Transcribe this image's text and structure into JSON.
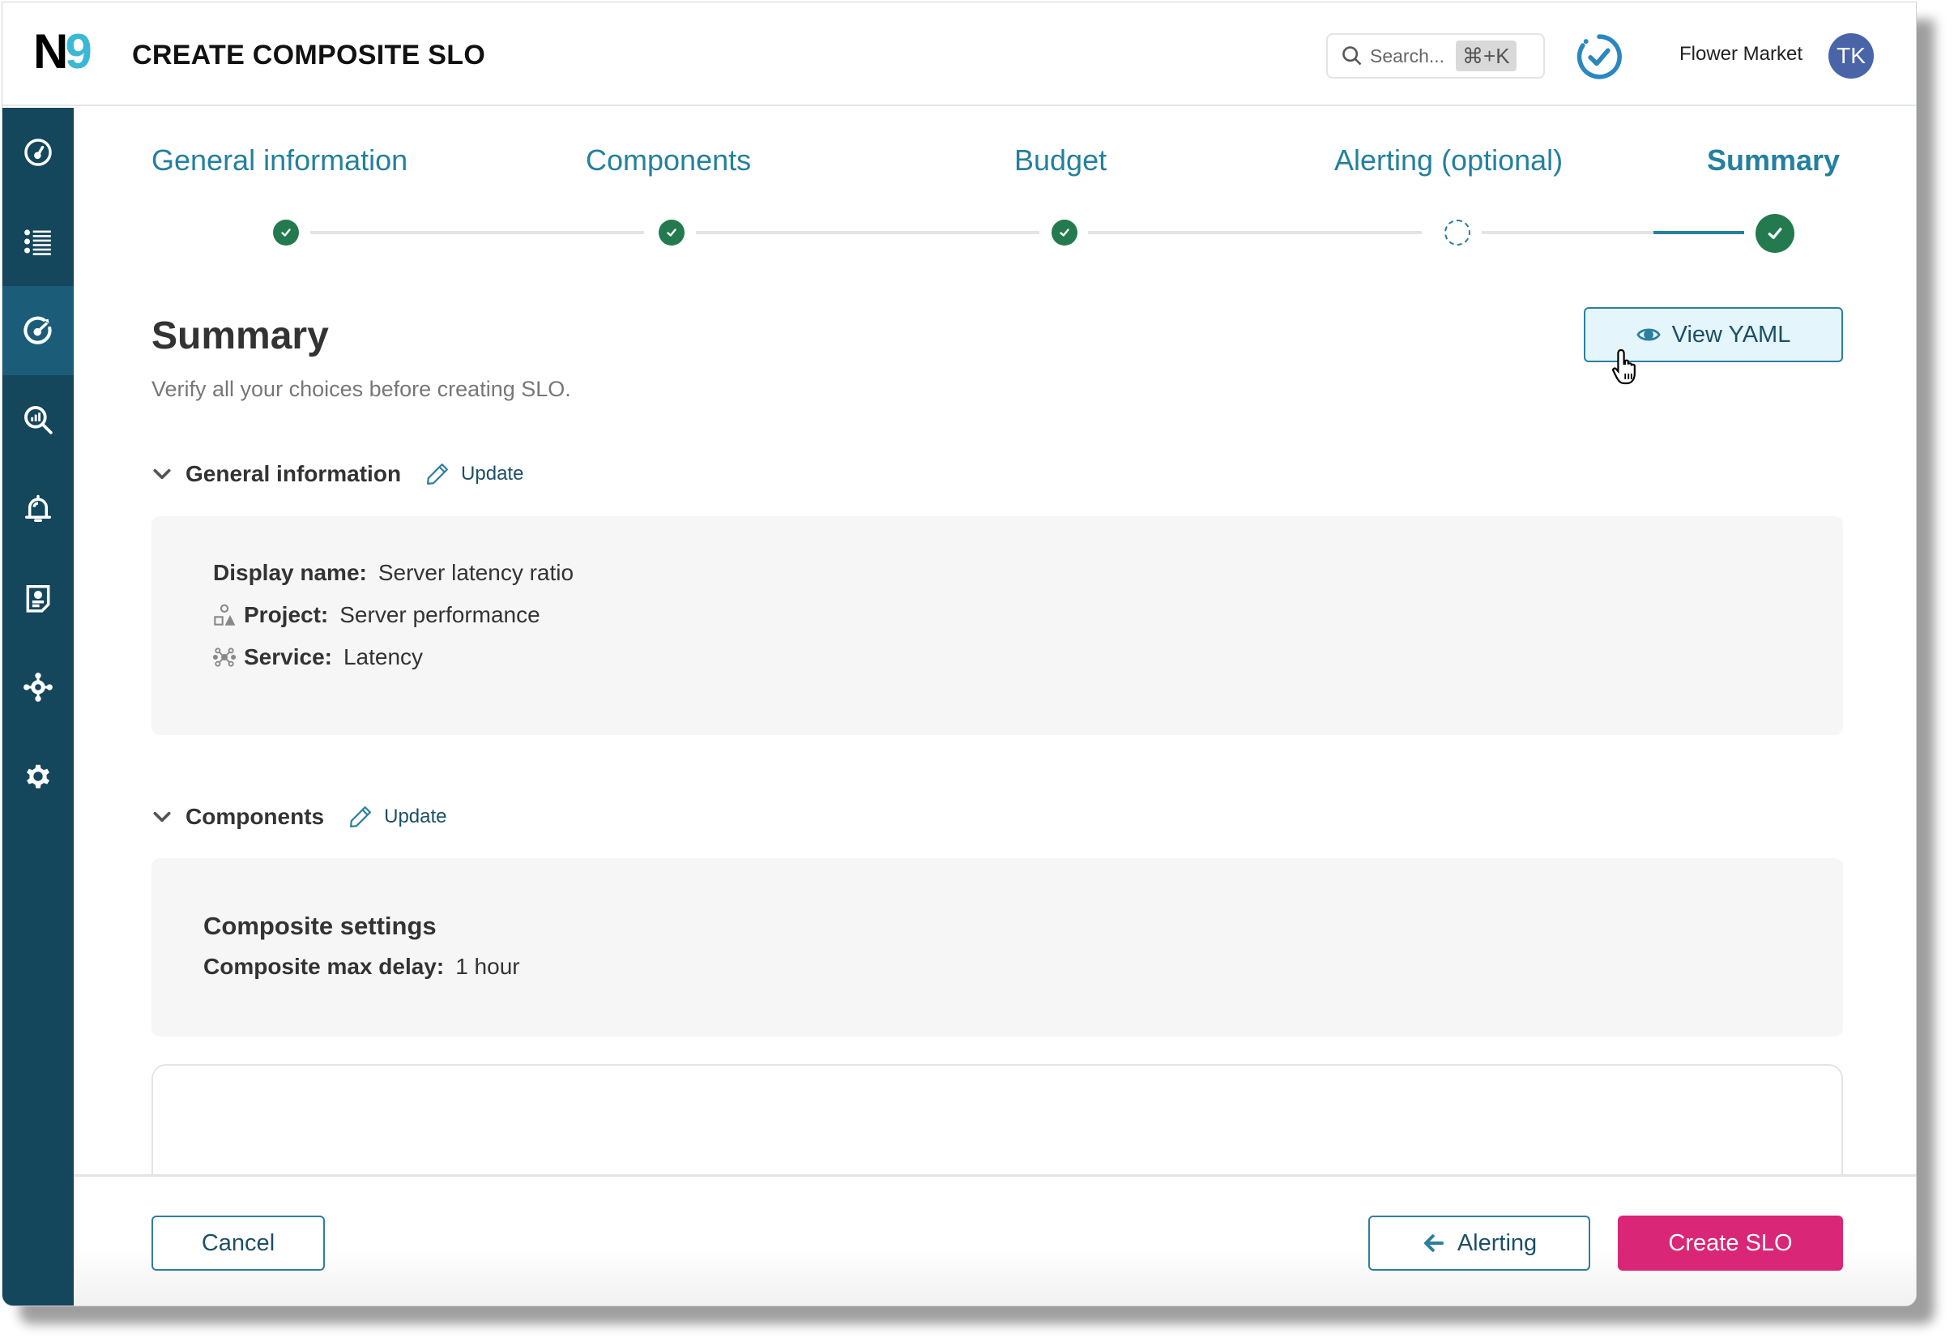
{
  "header": {
    "logo_left": "N",
    "logo_right": "9",
    "title": "CREATE COMPOSITE SLO",
    "search_placeholder": "Search...",
    "search_shortcut": "⌘+K",
    "org_name": "Flower Market",
    "avatar_initials": "TK"
  },
  "sidebar": {
    "items": [
      {
        "icon": "dashboard-gauge-icon",
        "active": false
      },
      {
        "icon": "list-icon",
        "active": false
      },
      {
        "icon": "slo-target-icon",
        "active": true
      },
      {
        "icon": "analytics-search-icon",
        "active": false
      },
      {
        "icon": "alert-bell-icon",
        "active": false
      },
      {
        "icon": "report-icon",
        "active": false
      },
      {
        "icon": "integrations-icon",
        "active": false
      },
      {
        "icon": "settings-gear-icon",
        "active": false
      }
    ]
  },
  "stepper": {
    "steps": [
      {
        "label": "General information",
        "status": "complete"
      },
      {
        "label": "Components",
        "status": "complete"
      },
      {
        "label": "Budget",
        "status": "complete"
      },
      {
        "label": "Alerting (optional)",
        "status": "skipped"
      },
      {
        "label": "Summary",
        "status": "current"
      }
    ]
  },
  "summary": {
    "title": "Summary",
    "subtitle": "Verify all your choices before creating SLO.",
    "view_yaml_label": "View YAML"
  },
  "general_information": {
    "section_title": "General information",
    "update_label": "Update",
    "fields": [
      {
        "key": "Display name:",
        "value": "Server latency ratio",
        "icon": null
      },
      {
        "key": "Project:",
        "value": "Server performance",
        "icon": "project-icon"
      },
      {
        "key": "Service:",
        "value": "Latency",
        "icon": "service-icon"
      }
    ]
  },
  "components": {
    "section_title": "Components",
    "update_label": "Update",
    "panel_heading": "Composite settings",
    "fields": [
      {
        "key": "Composite max delay:",
        "value": "1 hour"
      }
    ]
  },
  "footer": {
    "cancel_label": "Cancel",
    "back_label": "Alerting",
    "create_label": "Create SLO"
  },
  "colors": {
    "brand_dark": "#14465c",
    "sidebar_active": "#1b5d79",
    "accent_teal": "#23809f",
    "success_green": "#237a4e",
    "primary_pink": "#da2676",
    "avatar_bg": "#4a64a8"
  }
}
